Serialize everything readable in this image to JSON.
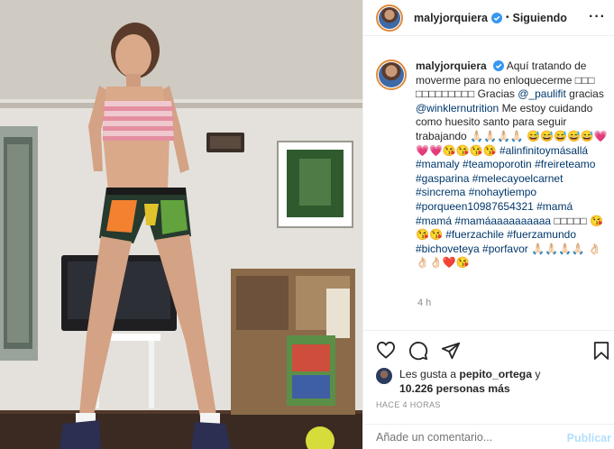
{
  "header": {
    "username": "malyjorquiera",
    "separator": "•",
    "follow_status": "Siguiendo",
    "more_glyph": "···"
  },
  "caption": {
    "username": "malyjorquiera",
    "line1": "Aquí tratando de moverme para no enloquecerme",
    "boxes1": "□□□ □□□□□□□□□",
    "line2a": "Gracias",
    "mention1": "@_paulifit",
    "line2b": "gracias",
    "mention2": "@winklernutrition",
    "line3": "Me estoy cuidando como huesito santo para seguir trabajando",
    "emoji_run1": "🙏🏻🙏🏻🙏🏻🙏🏻 😅😅😅😅😅💗💗💗😘😘😘😘",
    "hashtags1": "#alinfinitoymásallá #mamaly #teamoporotin #freireteamo #gasparina #melecayoelcarnet #sincrema #nohaytiempo #porqueen10987654321 #mamá #mamá #mamáaaaaaaaaaa",
    "boxes2": "□□□□□",
    "emoji_run2": "😘😘😘",
    "hashtags2": "#fuerzachile #fuerzamundo #bichoveteya #porfavor",
    "emoji_run3": "🙏🏻🙏🏻🙏🏻🙏🏻 👌🏻👌🏻👌🏻❤️😘",
    "time": "4 h"
  },
  "likes": {
    "prefix": "Les gusta a",
    "user": "pepito_ortega",
    "joiner": "y",
    "count": "10.226 personas más"
  },
  "timestamp": "HACE 4 HORAS",
  "comment": {
    "placeholder": "Añade un comentario...",
    "publish": "Publicar"
  },
  "colors": {
    "link": "#00376b",
    "verified": "#3897f0",
    "muted": "#8e8e8e",
    "publish_disabled": "#b2dffc",
    "avatar_ring": "#e08a3a"
  },
  "icons": {
    "like": "heart-icon",
    "comment": "comment-bubble-icon",
    "share": "paper-plane-icon",
    "save": "bookmark-icon",
    "verified": "verified-badge-icon",
    "more": "more-options-icon"
  }
}
